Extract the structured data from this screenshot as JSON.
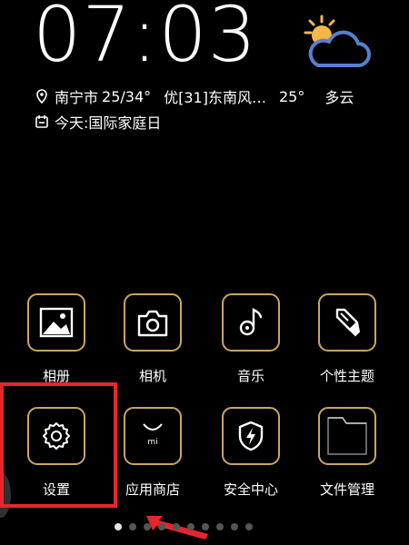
{
  "clock": "07:03",
  "weather": {
    "city": "南宁市",
    "temp_range": "25/34°",
    "aqi": "优[31]",
    "wind": "东南风…",
    "temp_now": "25°",
    "condition": "多云",
    "icon": "partly-cloudy-icon"
  },
  "event": "今天:国际家庭日",
  "apps": [
    {
      "label": "相册",
      "icon": "gallery-icon"
    },
    {
      "label": "相机",
      "icon": "camera-icon"
    },
    {
      "label": "音乐",
      "icon": "music-icon"
    },
    {
      "label": "个性主题",
      "icon": "theme-brush-icon"
    },
    {
      "label": "设置",
      "icon": "gear-icon"
    },
    {
      "label": "应用商店",
      "icon": "app-store-bag-icon"
    },
    {
      "label": "安全中心",
      "icon": "shield-bolt-icon"
    },
    {
      "label": "文件管理",
      "icon": "folder-icon"
    }
  ],
  "pager": {
    "total": 10,
    "current": 1
  },
  "colors": {
    "tile_border": "#c9a566",
    "highlight": "#e8252b",
    "sun": "#f2b84b",
    "cloud": "#5a7fd0"
  }
}
